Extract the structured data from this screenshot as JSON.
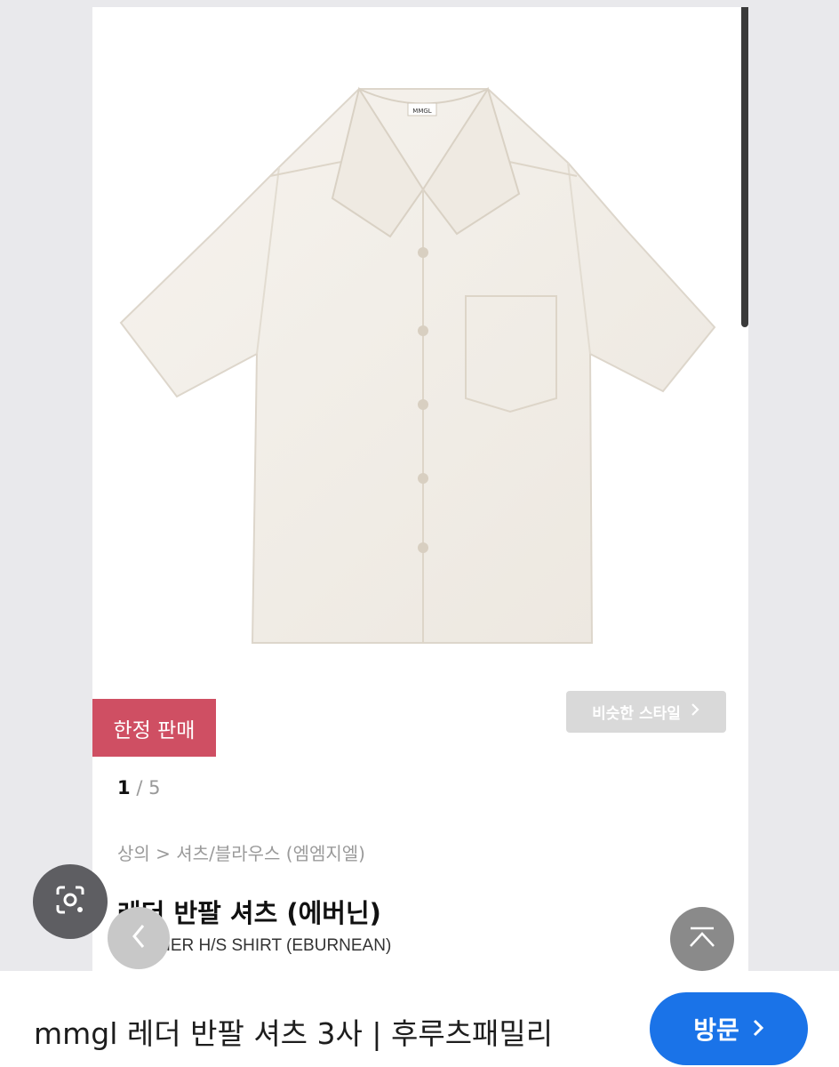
{
  "product": {
    "badge": "한정 판매",
    "similar_style": "비슷한 스타일",
    "pager_current": "1",
    "pager_sep": "/",
    "pager_total": "5",
    "breadcrumb": "상의 > 셔츠/블라우스 (엠엠지엘)",
    "title": "레더 반팔 셔츠 (에버닌)",
    "subtitle": "LEATHER H/S SHIRT (EBURNEAN)",
    "shirt_label": "MMGL"
  },
  "result": {
    "title": "mmgl 레더 반팔 셔츠 3사 | 후루츠패밀리",
    "visit": "방문"
  },
  "icons": {
    "lens": "google-lens-icon",
    "prev": "chevron-left-icon",
    "top": "scroll-top-icon",
    "similar_arrow": "chevron-right-icon",
    "visit_arrow": "chevron-right-icon"
  },
  "colors": {
    "badge": "#cf4f63",
    "visit": "#1a73e8",
    "shirt": "#f3efe8"
  }
}
